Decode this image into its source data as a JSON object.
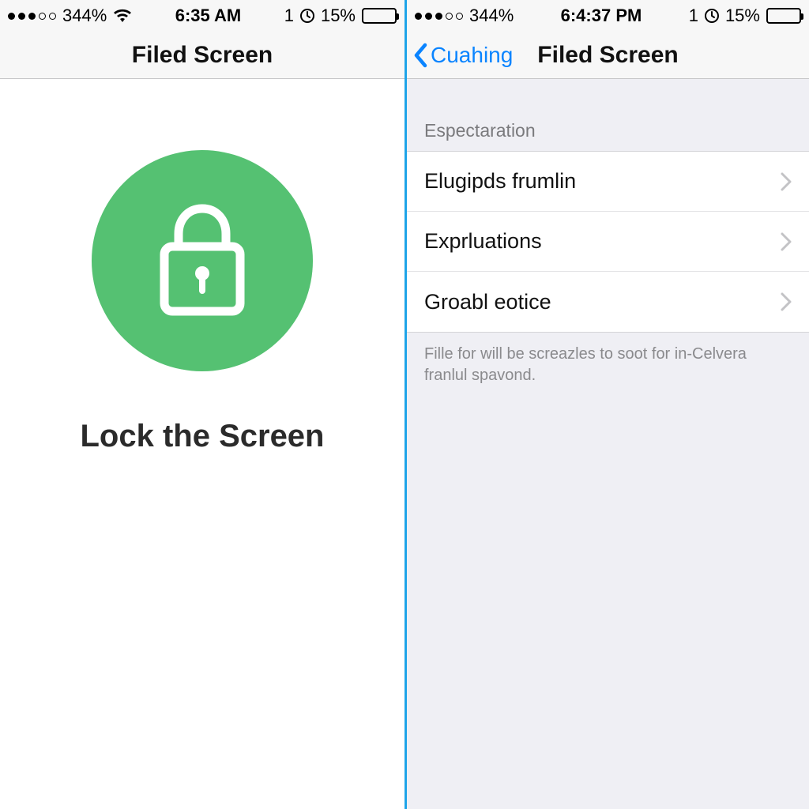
{
  "colors": {
    "accent_blue": "#0a84ff",
    "divider_blue": "#1ea4e8",
    "lock_green": "#55c172",
    "bg_grouped": "#efeff4",
    "text_secondary": "#8a8a8d",
    "chevron_gray": "#c3c3c6"
  },
  "left": {
    "status": {
      "carrier_percent": "344%",
      "time": "6:35 AM",
      "battery_text": "15%",
      "location_indicator": "1",
      "signal_dots": {
        "filled": 3,
        "total": 5
      }
    },
    "nav": {
      "title": "Filed Screen"
    },
    "main": {
      "icon_name": "lock-icon",
      "caption": "Lock the Screen"
    }
  },
  "right": {
    "status": {
      "carrier_percent": "344%",
      "time": "6:4:37 PM",
      "battery_text": "15%",
      "location_indicator": "1",
      "signal_dots": {
        "filled": 3,
        "total": 5
      }
    },
    "nav": {
      "back_label": "Cuahing",
      "title": "Filed Screen"
    },
    "section_header": "Espectaration",
    "rows": [
      {
        "label": "Elugipds frumlin"
      },
      {
        "label": "Exprluations"
      },
      {
        "label": "Groabl eotice"
      }
    ],
    "section_footer": "Fille for will be screazles to soot for in-Celvera franlul spavond."
  }
}
